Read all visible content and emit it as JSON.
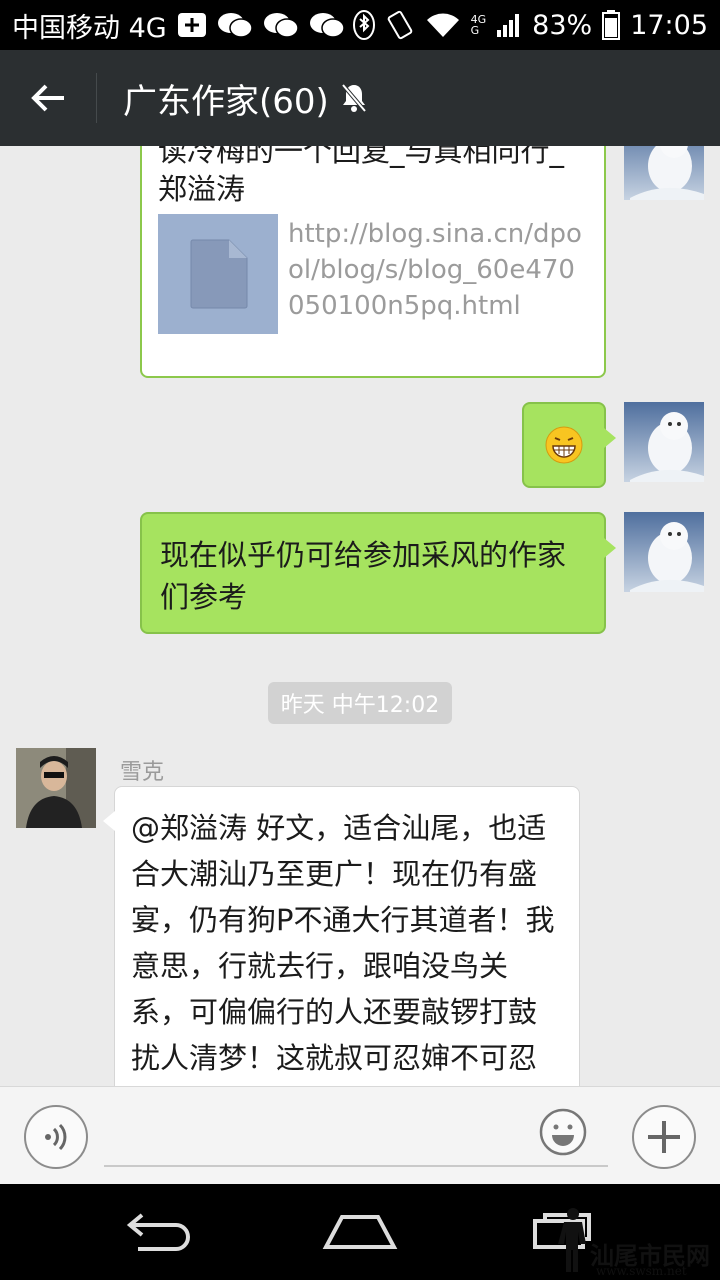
{
  "status_bar": {
    "carrier": "中国移动 4G",
    "network_small_top": "4G",
    "network_small_bottom": "G",
    "battery": "83%",
    "time": "17:05"
  },
  "header": {
    "title": "广东作家(60)"
  },
  "messages": {
    "link_card": {
      "title": "读冷梅的一个回复_与真相同行_郑溢涛",
      "url": "http://blog.sina.cn/dpool/blog/s/blog_60e470050100n5pq.html"
    },
    "emoji_msg": "😁",
    "text_msg": "现在似乎仍可给参加采风的作家们参考",
    "timestamp": "昨天 中午12:02",
    "reply": {
      "sender": "雪克",
      "text": "@郑溢涛 好文，适合汕尾，也适合大潮汕乃至更广！现在仍有盛宴，仍有狗P不通大行其道者！我意思，行就去行，跟咱没鸟关系，可偏偏行的人还要敲锣打鼓扰人清梦！这就叔可忍婶不可忍了！"
    }
  },
  "input_bar": {
    "placeholder": ""
  },
  "watermark": {
    "text": "汕尾市民网",
    "url": "www.swsm.net"
  }
}
